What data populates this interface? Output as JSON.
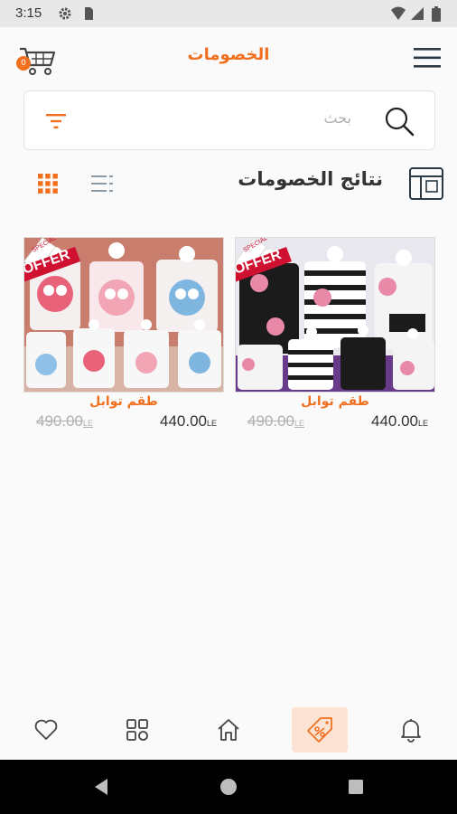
{
  "status_bar": {
    "time": "3:15"
  },
  "app_bar": {
    "title": "الخصومات",
    "cart_count": "0"
  },
  "search": {
    "placeholder": "بحث"
  },
  "results": {
    "title": "نتائج الخصومات"
  },
  "products": [
    {
      "name": "طقم توابل",
      "price": "440.00",
      "old_price": "490.00",
      "currency": "LE",
      "badge": "OFFER",
      "badge_top": "SPECIAL"
    },
    {
      "name": "طقم توابل",
      "price": "440.00",
      "old_price": "490.00",
      "currency": "LE",
      "badge": "OFFER",
      "badge_top": "SPECIAL"
    }
  ],
  "colors": {
    "accent": "#f07020",
    "active_nav_bg": "#fde3d4"
  },
  "icons": [
    "cart-icon",
    "menu-icon",
    "search-icon",
    "filter-icon",
    "grid-view-icon",
    "list-view-icon",
    "template-icon",
    "heart-icon",
    "categories-icon",
    "home-icon",
    "offers-tag-icon",
    "bell-icon"
  ]
}
